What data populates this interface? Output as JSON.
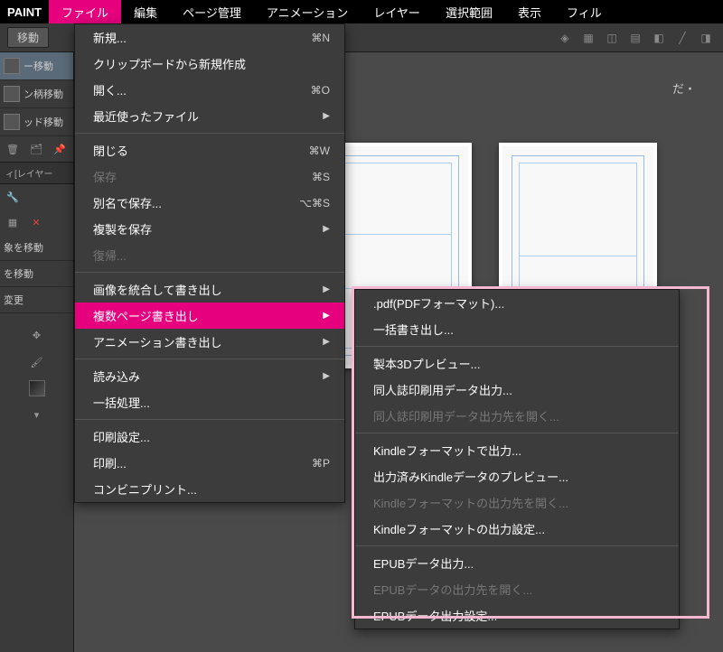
{
  "app_name": "PAINT",
  "menubar": {
    "items": [
      "ファイル",
      "編集",
      "ページ管理",
      "アニメーション",
      "レイヤー",
      "選択範囲",
      "表示",
      "フィル"
    ],
    "active_index": 0
  },
  "toolbar": {
    "tab_label": "移動",
    "right_label": "だ・"
  },
  "left_panel": {
    "tool_rows": [
      {
        "label": "ー移動",
        "selected": true
      },
      {
        "label": "ン柄移動",
        "selected": false
      },
      {
        "label": "ッド移動",
        "selected": false
      }
    ],
    "section_label": "ィ[レイヤー",
    "options": [
      "象を移動",
      "を移動",
      "変更"
    ]
  },
  "file_menu": {
    "groups": [
      [
        {
          "label": "新規...",
          "shortcut": "⌘N"
        },
        {
          "label": "クリップボードから新規作成"
        },
        {
          "label": "開く...",
          "shortcut": "⌘O"
        },
        {
          "label": "最近使ったファイル",
          "submenu": true
        }
      ],
      [
        {
          "label": "閉じる",
          "shortcut": "⌘W"
        },
        {
          "label": "保存",
          "shortcut": "⌘S",
          "disabled": true
        },
        {
          "label": "別名で保存...",
          "shortcut": "⌥⌘S"
        },
        {
          "label": "複製を保存",
          "submenu": true
        },
        {
          "label": "復帰...",
          "disabled": true
        }
      ],
      [
        {
          "label": "画像を統合して書き出し",
          "submenu": true
        },
        {
          "label": "複数ページ書き出し",
          "submenu": true,
          "highlight": true
        },
        {
          "label": "アニメーション書き出し",
          "submenu": true
        }
      ],
      [
        {
          "label": "読み込み",
          "submenu": true
        },
        {
          "label": "一括処理..."
        }
      ],
      [
        {
          "label": "印刷設定..."
        },
        {
          "label": "印刷...",
          "shortcut": "⌘P"
        },
        {
          "label": "コンビニプリント..."
        }
      ]
    ]
  },
  "submenu": {
    "groups": [
      [
        {
          "label": ".pdf(PDFフォーマット)..."
        },
        {
          "label": "一括書き出し..."
        }
      ],
      [
        {
          "label": "製本3Dプレビュー..."
        },
        {
          "label": "同人誌印刷用データ出力..."
        },
        {
          "label": "同人誌印刷用データ出力先を開く...",
          "disabled": true
        }
      ],
      [
        {
          "label": "Kindleフォーマットで出力..."
        },
        {
          "label": "出力済みKindleデータのプレビュー..."
        },
        {
          "label": "Kindleフォーマットの出力先を開く...",
          "disabled": true
        },
        {
          "label": "Kindleフォーマットの出力設定..."
        }
      ],
      [
        {
          "label": "EPUBデータ出力..."
        },
        {
          "label": "EPUBデータの出力先を開く...",
          "disabled": true
        },
        {
          "label": "EPUBデータ出力設定..."
        }
      ]
    ]
  }
}
